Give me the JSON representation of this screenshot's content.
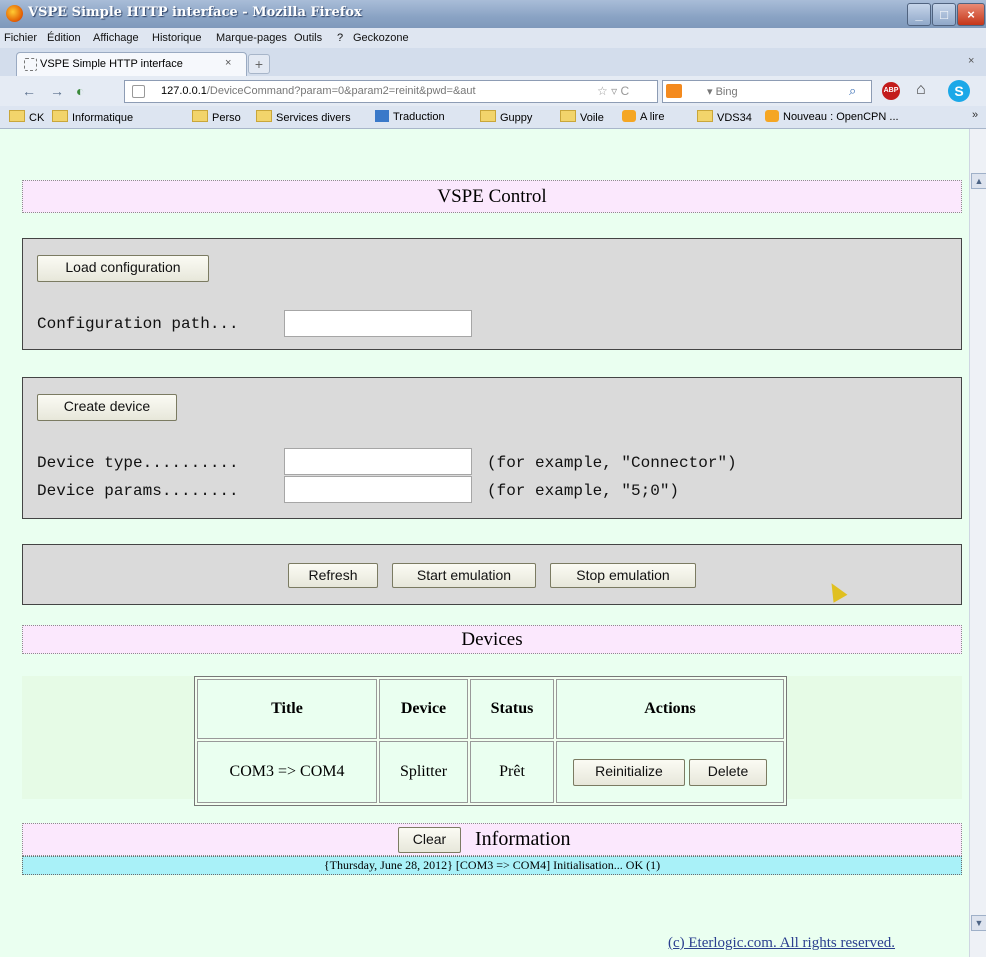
{
  "window": {
    "title": "VSPE Simple HTTP interface - Mozilla Firefox",
    "min_glyph": "_",
    "max_glyph": "□",
    "close_glyph": "×"
  },
  "menu": [
    "Fichier",
    "Édition",
    "Affichage",
    "Historique",
    "Marque-pages",
    "Outils",
    "?",
    "Geckozone"
  ],
  "tab": {
    "label": "VSPE Simple HTTP interface",
    "close": "×",
    "new_tab": "+"
  },
  "nav": {
    "back": "←",
    "forward": "→",
    "url_host": "127.0.0.1",
    "url_path": "/DeviceCommand?param=0&param2=reinit&pwd=&aut",
    "url_icons": "☆ ▿ C",
    "search_engine": "▾ Bing",
    "home": "⌂",
    "abp": "ABP",
    "skype": "S"
  },
  "bookmarks": [
    {
      "label": "CK",
      "icon": "folder-icon"
    },
    {
      "label": "Informatique",
      "icon": "folder-icon"
    },
    {
      "label": "Perso",
      "icon": "folder-icon"
    },
    {
      "label": "Services divers",
      "icon": "folder-icon"
    },
    {
      "label": "Traduction",
      "icon": "translate-icon"
    },
    {
      "label": "Guppy",
      "icon": "folder-icon"
    },
    {
      "label": "Voile",
      "icon": "folder-icon"
    },
    {
      "label": "A lire",
      "icon": "feed-icon"
    },
    {
      "label": "VDS34",
      "icon": "folder-icon"
    },
    {
      "label": "Nouveau : OpenCPN ...",
      "icon": "feed-icon"
    }
  ],
  "bookmarks_more": "»",
  "page": {
    "title": "VSPE Control",
    "load_config": {
      "button": "Load configuration",
      "path_label": "Configuration path...",
      "path_value": ""
    },
    "create_device": {
      "button": "Create device",
      "type_label": "Device type..........",
      "type_value": "",
      "type_hint": "(for example, \"Connector\")",
      "params_label": "Device params........",
      "params_value": "",
      "params_hint": "(for example, \"5;0\")"
    },
    "controls": {
      "refresh": "Refresh",
      "start": "Start emulation",
      "stop": "Stop emulation"
    },
    "devices_title": "Devices",
    "devices_table": {
      "headers": [
        "Title",
        "Device",
        "Status",
        "Actions"
      ],
      "rows": [
        {
          "title": "COM3 => COM4",
          "device": "Splitter",
          "status": "Prêt",
          "reinit": "Reinitialize",
          "delete": "Delete"
        }
      ]
    },
    "info": {
      "clear": "Clear",
      "title": "Information",
      "log": "{Thursday, June 28, 2012} [COM3 => COM4] Initialisation... OK (1)"
    },
    "footer": "(c) Eterlogic.com. All rights reserved."
  }
}
